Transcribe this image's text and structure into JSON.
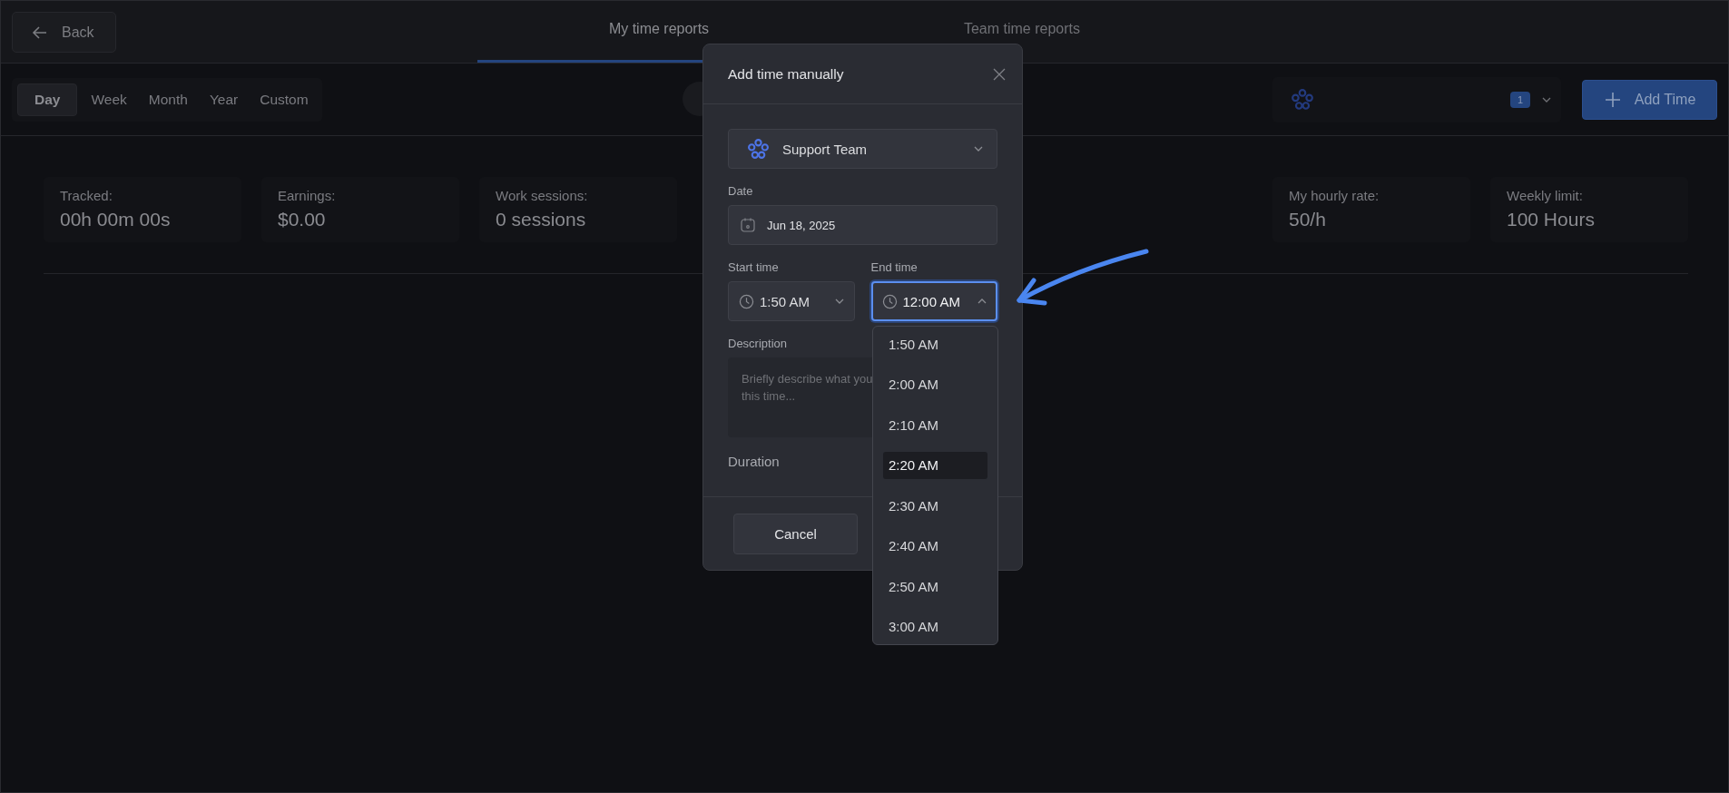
{
  "back_button": {
    "label": "Back"
  },
  "tabs": [
    {
      "label": "My time reports",
      "selected": true
    },
    {
      "label": "Team time reports",
      "selected": false
    }
  ],
  "ranges": [
    {
      "label": "Day",
      "selected": true
    },
    {
      "label": "Week",
      "selected": false
    },
    {
      "label": "Month",
      "selected": false
    },
    {
      "label": "Year",
      "selected": false
    },
    {
      "label": "Custom",
      "selected": false
    }
  ],
  "team_selector": {
    "badge": "1"
  },
  "add_button": {
    "label": "Add Time"
  },
  "stats_left": [
    {
      "label": "Tracked:",
      "value": "00h 00m 00s"
    },
    {
      "label": "Earnings:",
      "value": "$0.00"
    },
    {
      "label": "Work sessions:",
      "value": "0 sessions"
    }
  ],
  "stats_right": [
    {
      "label": "My hourly rate:",
      "value": "50/h"
    },
    {
      "label": "Weekly limit:",
      "value": "100 Hours"
    }
  ],
  "modal": {
    "title": "Add time manually",
    "team": "Support Team",
    "date_label": "Date",
    "date": "Jun 18, 2025",
    "start_label": "Start time",
    "start_time": "1:50 AM",
    "end_label": "End time",
    "end_time": "12:00 AM",
    "end_open": true,
    "description_label": "Description",
    "description_placeholder": "Briefly describe what you\nthis time...",
    "duration_label": "Duration",
    "cancel": "Cancel"
  },
  "end_time_options": [
    {
      "label": "1:50 AM",
      "selected": false
    },
    {
      "label": "2:00 AM",
      "selected": false
    },
    {
      "label": "2:10 AM",
      "selected": false
    },
    {
      "label": "2:20 AM",
      "selected": true
    },
    {
      "label": "2:30 AM",
      "selected": false
    },
    {
      "label": "2:40 AM",
      "selected": false
    },
    {
      "label": "2:50 AM",
      "selected": false
    },
    {
      "label": "3:00 AM",
      "selected": false
    }
  ]
}
